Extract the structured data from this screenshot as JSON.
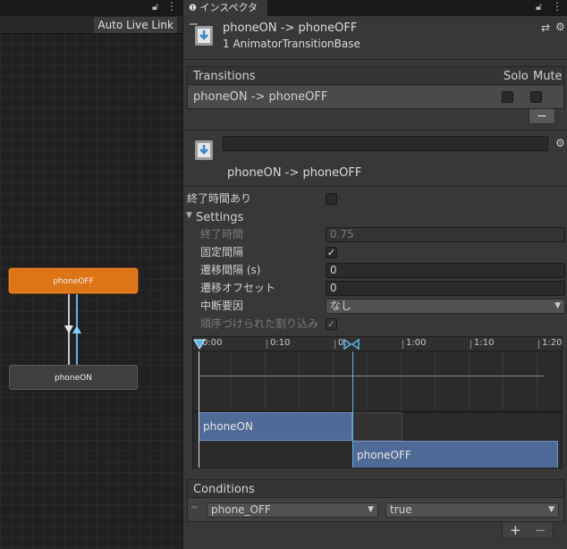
{
  "graph": {
    "auto_live_link": "Auto Live Link",
    "node_off_label": "phoneOFF",
    "node_on_label": "phoneON"
  },
  "inspector": {
    "tab_label": "インスペクター",
    "header_title": "phoneON -> phoneOFF",
    "header_subtitle": "1 AnimatorTransitionBase",
    "transitions": {
      "header": "Transitions",
      "solo_label": "Solo",
      "mute_label": "Mute",
      "row_label": "phoneON -> phoneOFF",
      "remove_label": "−"
    },
    "transition": {
      "name_value": "",
      "title": "phoneON -> phoneOFF",
      "has_exit_time_label": "終了時間あり",
      "settings_label": "Settings",
      "exit_time_label": "終了時間",
      "exit_time_value": "0.75",
      "fixed_duration_label": "固定間隔",
      "duration_label": "遷移間隔 (s)",
      "duration_value": "0",
      "offset_label": "遷移オフセット",
      "offset_value": "0",
      "interruption_label": "中断要因",
      "interruption_value": "なし",
      "ordered_interruption_label": "順序づけられた割り込み"
    },
    "timeline": {
      "ticks": [
        "0:00",
        "0:10",
        "0:",
        "1:00",
        "1:10",
        "1:20"
      ],
      "bar_on_label": "phoneON",
      "bar_off_label": "phoneOFF"
    },
    "conditions": {
      "header": "Conditions",
      "parameter_value": "phone_OFF",
      "condition_value": "true",
      "add_label": "+",
      "remove_label": "−"
    }
  },
  "colors": {
    "accent_orange": "#dd7416",
    "timeline_blue": "#4f6a96",
    "transition_arrow": "#5ab4e6"
  }
}
